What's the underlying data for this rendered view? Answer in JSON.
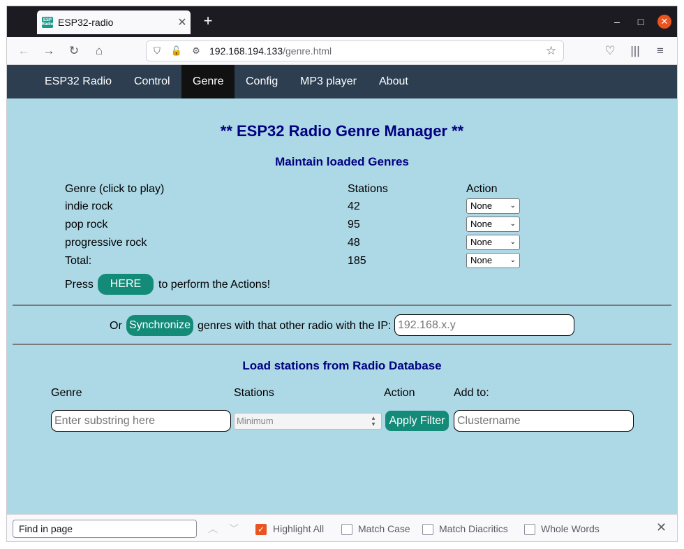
{
  "browser": {
    "tab_title": "ESP32-radio",
    "favicon_text": "ESP Radio",
    "url_host": "192.168.194.133",
    "url_path": "/genre.html"
  },
  "nav": {
    "items": [
      "ESP32 Radio",
      "Control",
      "Genre",
      "Config",
      "MP3 player",
      "About"
    ],
    "active": "Genre"
  },
  "page": {
    "title": "** ESP32 Radio Genre Manager **",
    "maintain_heading": "Maintain loaded Genres",
    "table": {
      "headers": [
        "Genre (click to play)",
        "Stations",
        "Action"
      ],
      "rows": [
        {
          "genre": "indie rock",
          "stations": "42",
          "action": "None"
        },
        {
          "genre": "pop rock",
          "stations": "95",
          "action": "None"
        },
        {
          "genre": "progressive rock",
          "stations": "48",
          "action": "None"
        },
        {
          "genre": "Total:",
          "stations": "185",
          "action": "None"
        }
      ]
    },
    "press_text": "Press",
    "here_button": "HERE",
    "perform_text": "to perform the Actions!",
    "or_text": "Or",
    "sync_button": "Synchronize",
    "sync_text": "genres with that other radio with the IP:",
    "ip_placeholder": "192.168.x.y",
    "load_heading": "Load stations from Radio Database",
    "filter": {
      "genre_label": "Genre",
      "stations_label": "Stations",
      "action_label": "Action",
      "addto_label": "Add to:",
      "genre_placeholder": "Enter substring here",
      "stations_placeholder": "Minimum",
      "apply_button": "Apply Filter",
      "cluster_placeholder": "Clustername"
    }
  },
  "findbar": {
    "placeholder": "Find in page",
    "highlight_all": "Highlight All",
    "match_case": "Match Case",
    "match_diacritics": "Match Diacritics",
    "whole_words": "Whole Words"
  }
}
